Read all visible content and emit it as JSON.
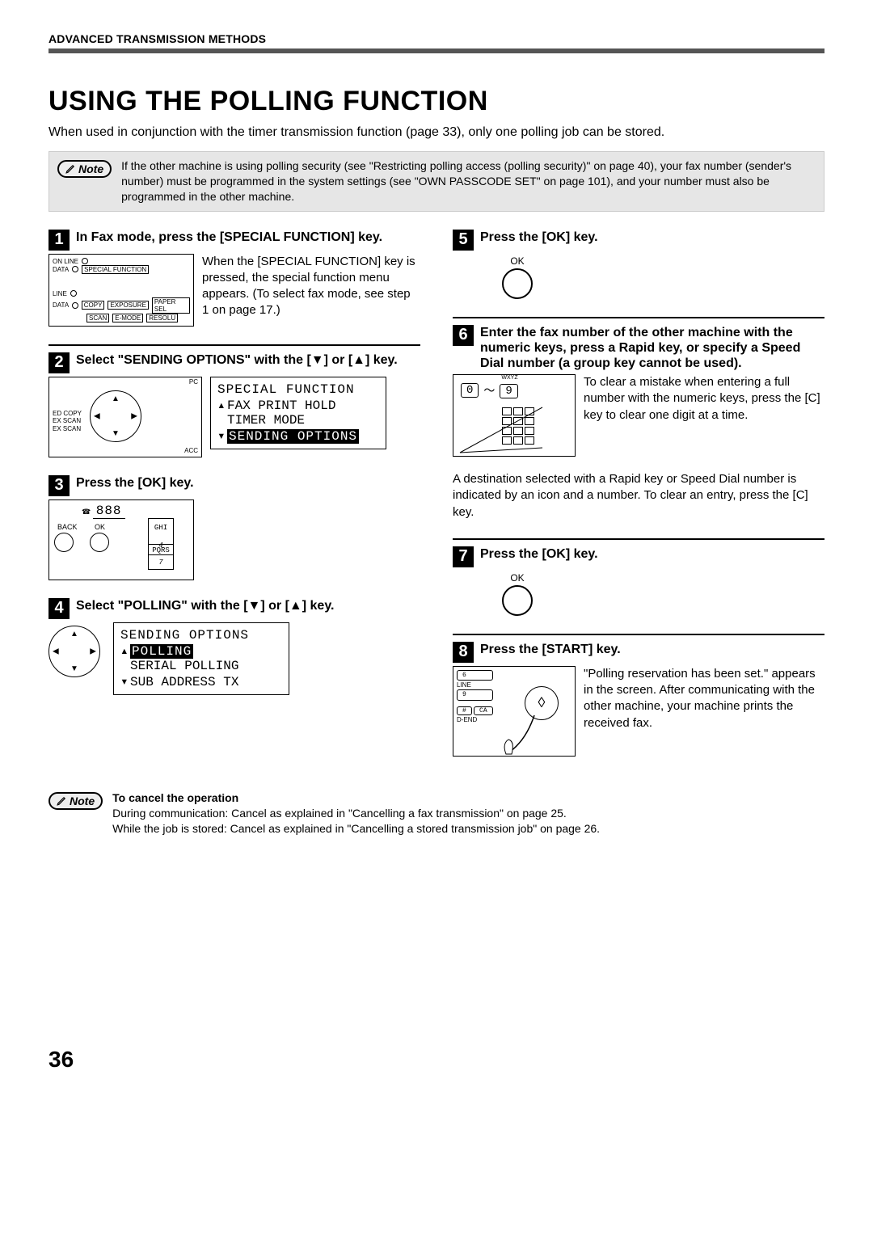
{
  "header": "ADVANCED TRANSMISSION METHODS",
  "title": "USING THE POLLING FUNCTION",
  "intro": "When used in conjunction with the timer transmission function (page 33), only one polling job can be stored.",
  "note1": {
    "label": "Note",
    "text": "If the other machine is using polling security (see \"Restricting polling access (polling security)\" on page 40), your fax number (sender's number) must be programmed in the system settings (see \"OWN PASSCODE SET\" on page 101), and your number must also be programmed in the other machine."
  },
  "steps": {
    "s1": {
      "num": "1",
      "title": "In Fax mode, press the [SPECIAL FUNCTION] key.",
      "text": "When the [SPECIAL FUNCTION] key is pressed, the special function menu appears. (To select fax mode, see step 1 on page 17.)",
      "panel": {
        "online": "ON LINE",
        "data": "DATA",
        "special": "SPECIAL FUNCTION",
        "line": "LINE",
        "data2": "DATA",
        "copy": "COPY",
        "scan": "SCAN",
        "exposure": "EXPOSURE",
        "emode": "E-MODE",
        "paper": "PAPER SEL",
        "resolu": "RESOLU"
      }
    },
    "s2": {
      "num": "2",
      "title": "Select \"SENDING OPTIONS\" with the [▼] or [▲] key.",
      "panel": {
        "ed": "ED COPY",
        "exscan1": "EX SCAN",
        "exscan2": "EX SCAN",
        "pc": "PC",
        "acc": "ACC"
      },
      "menu": {
        "title": "SPECIAL FUNCTION",
        "l1": "FAX PRINT HOLD",
        "l2": "TIMER MODE",
        "l3": "SENDING OPTIONS"
      }
    },
    "s3": {
      "num": "3",
      "title": "Press the [OK] key.",
      "panel": {
        "back": "BACK",
        "ok": "OK",
        "digits": "888",
        "ghi": "GHI",
        "four": "4",
        "pqrs": "PQRS",
        "seven": "7"
      }
    },
    "s4": {
      "num": "4",
      "title": "Select \"POLLING\" with the [▼] or [▲] key.",
      "menu": {
        "title": "SENDING OPTIONS",
        "l1": "POLLING",
        "l2": "SERIAL POLLING",
        "l3": "SUB ADDRESS TX"
      }
    },
    "s5": {
      "num": "5",
      "title": "Press the [OK] key.",
      "ok": "OK"
    },
    "s6": {
      "num": "6",
      "title": "Enter the fax number of the other machine with the numeric keys, press a Rapid key, or specify a Speed Dial number (a group key cannot be used).",
      "text": "To clear a mistake when entering a full number with the numeric keys, press the [C] key to clear one digit at a time.",
      "keys": {
        "zero": "0",
        "tilde": "〜",
        "nine": "9",
        "wxyz": "WXYZ"
      },
      "desttext": "A destination selected with a Rapid key or Speed Dial number is indicated by an icon and a number. To clear an entry, press the [C] key."
    },
    "s7": {
      "num": "7",
      "title": "Press the [OK] key.",
      "ok": "OK"
    },
    "s8": {
      "num": "8",
      "title": "Press the [START] key.",
      "text": "\"Polling reservation has been set.\" appears in the screen. After communicating with the other machine, your machine prints the received fax.",
      "panel": {
        "six": "6",
        "nine": "9",
        "hash": "#",
        "ca": "CA",
        "line": "LINE",
        "dend": "D-END"
      }
    }
  },
  "note2": {
    "label": "Note",
    "title": "To cancel the operation",
    "l1": "During communication: Cancel as explained in \"Cancelling a fax transmission\" on page 25.",
    "l2": "While the job is stored: Cancel as explained in \"Cancelling a stored transmission job\" on page 26."
  },
  "page_number": "36"
}
